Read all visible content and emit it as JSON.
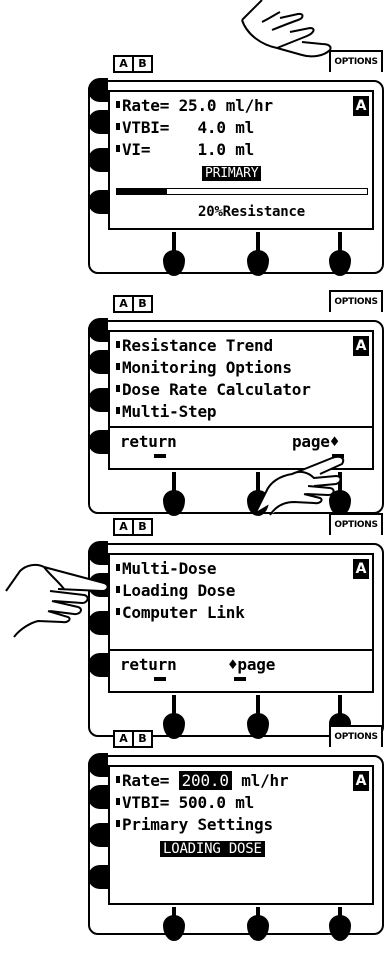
{
  "panels": [
    {
      "tabs": [
        "A",
        "B"
      ],
      "options_label": "OPTIONS",
      "channel": "A",
      "lines": [
        {
          "bullet": true,
          "text": "Rate= 25.0 ml/hr"
        },
        {
          "bullet": true,
          "text": "VTBI=   4.0 ml"
        },
        {
          "bullet": true,
          "text": "VI=     1.0 ml"
        }
      ],
      "status": "PRIMARY",
      "pressure_bar_fraction": 0.2,
      "footer": "20%Resistance"
    },
    {
      "tabs": [
        "A",
        "B"
      ],
      "options_label": "OPTIONS",
      "channel": "A",
      "lines": [
        {
          "bullet": true,
          "text": "Resistance Trend"
        },
        {
          "bullet": true,
          "text": "Monitoring Options"
        },
        {
          "bullet": true,
          "text": "Dose Rate Calculator"
        },
        {
          "bullet": true,
          "text": "Multi-Step"
        }
      ],
      "softkeys": {
        "left": "return",
        "right": "page♦"
      }
    },
    {
      "tabs": [
        "A",
        "B"
      ],
      "options_label": "OPTIONS",
      "channel": "A",
      "lines": [
        {
          "bullet": true,
          "text": "Multi-Dose"
        },
        {
          "bullet": true,
          "text": "Loading Dose"
        },
        {
          "bullet": true,
          "text": "Computer Link"
        }
      ],
      "softkeys": {
        "left": "return",
        "right": "♦page"
      }
    },
    {
      "tabs": [
        "A",
        "B"
      ],
      "options_label": "OPTIONS",
      "channel": "A",
      "rate_label": "Rate=",
      "rate_value": "200.0",
      "rate_unit": "ml/hr",
      "lines": [
        {
          "bullet": true,
          "text": "VTBI= 500.0 ml"
        },
        {
          "bullet": true,
          "text": "Primary Settings"
        }
      ],
      "status": "LOADING DOSE"
    }
  ],
  "icons": {
    "pointer": "pointing-hand-icon",
    "bullet": "square-bullet-icon",
    "page_arrow": "diamond-arrow-icon"
  }
}
